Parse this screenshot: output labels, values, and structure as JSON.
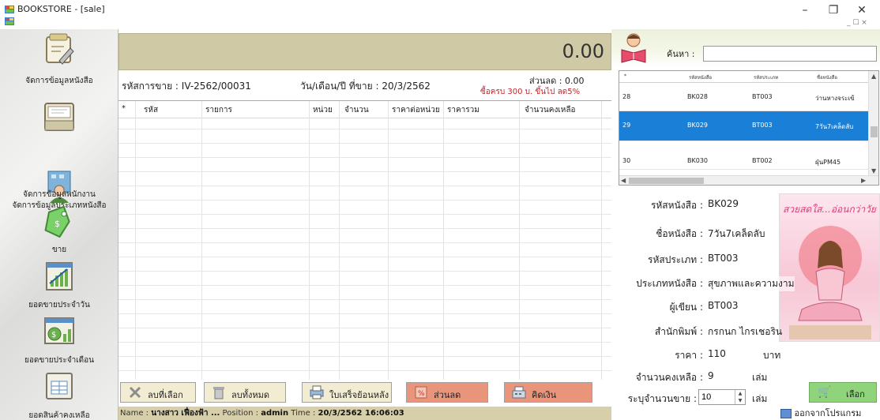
{
  "window": {
    "title": "BOOKSTORE - [sale]",
    "minimize": "–",
    "maximize": "❐",
    "close": "✕",
    "mdi_controls": "_ ☐ ×"
  },
  "sidebar": {
    "items": [
      {
        "label": "จัดการข้อมูลหนังสือ",
        "icon": "book-edit-icon"
      },
      {
        "label": "จัดการข้อมูลประเภทหนังสือ",
        "icon": "inbox-icon"
      },
      {
        "label": "จัดการข้อมูลพนักงาน",
        "icon": "employee-icon"
      },
      {
        "label": "ขาย",
        "icon": "price-tag-icon"
      },
      {
        "label": "ยอดขายประจำวัน",
        "icon": "daily-chart-icon"
      },
      {
        "label": "ยอดขายประจำเดือน",
        "icon": "monthly-money-icon"
      },
      {
        "label": "ยอดสินค้าคงเหลือ",
        "icon": "stock-table-icon"
      }
    ]
  },
  "sale": {
    "total": "0.00",
    "code_label": "รหัสการขาย :",
    "code_value": "IV-2562/00031",
    "date_label": "วัน/เดือน/ปี ที่ขาย :",
    "date_value": "20/3/2562",
    "discount_label": "ส่วนลด :",
    "discount_value": "0.00",
    "promo_text": "ซื้อครบ 300 บ. ขึ้นไป ลด5%"
  },
  "grid": {
    "columns": [
      "*",
      "รหัส",
      "รายการ",
      "หน่วย",
      "จำนวน",
      "ราคาต่อหน่วย",
      "ราคารวม",
      "จำนวนคงเหลือ"
    ]
  },
  "buttons": {
    "delete_selected": "ลบที่เลือก",
    "delete_all": "ลบทั้งหมด",
    "receipt": "ใบเสร็จย้อนหลัง",
    "discount": "ส่วนลด",
    "checkout": "คิดเงิน"
  },
  "status": {
    "name_label": "Name :",
    "name_value": "นางสาว เฟื่องฟ้า ...",
    "position_label": "Position :",
    "position_value": "admin",
    "time_label": "Time :",
    "time_value": "20/3/2562 16:06:03"
  },
  "search": {
    "label": "ค้นหา :",
    "value": ""
  },
  "book_list": {
    "columns": [
      "*",
      "รหัสหนังสือ",
      "รหัสประเภท",
      "ชื่อหนังสือ"
    ],
    "rows": [
      {
        "num": "28",
        "book_id": "BK028",
        "type_id": "BT003",
        "name": "ว่านหางจระเข้",
        "selected": false
      },
      {
        "num": "29",
        "book_id": "BK029",
        "type_id": "BT003",
        "name": "7วัน7เคล็ดลับ",
        "selected": true
      },
      {
        "num": "30",
        "book_id": "BK030",
        "type_id": "BT002",
        "name": "ฝุ่นPM45",
        "selected": false
      }
    ]
  },
  "detail": {
    "book_id_label": "รหัสหนังสือ :",
    "book_id_value": "BK029",
    "name_label": "ชื่อหนังสือ :",
    "name_value": "7วัน7เคล็ดลับ",
    "type_id_label": "รหัสประเภท :",
    "type_id_value": "BT003",
    "type_label": "ประเภทหนังสือ :",
    "type_value": "สุขภาพและความงาม",
    "author_label": "ผู้เขียน :",
    "author_value": "BT003",
    "publisher_label": "สำนักพิมพ์ :",
    "publisher_value": "กรกนก ไกรเชอริน",
    "price_label": "ราคา :",
    "price_value": "110",
    "price_unit": "บาท",
    "stock_label": "จำนวนคงเหลือ :",
    "stock_value": "9",
    "stock_unit": "เล่ม",
    "qty_label": "ระบุจำนวนขาย :",
    "qty_value": "10",
    "qty_unit": "เล่ม",
    "promo_image_text": "สวยสดใส...อ่อนกว่าวัย"
  },
  "actions": {
    "select": "เลือก",
    "exit": "ออกจากโปรแกรม"
  }
}
